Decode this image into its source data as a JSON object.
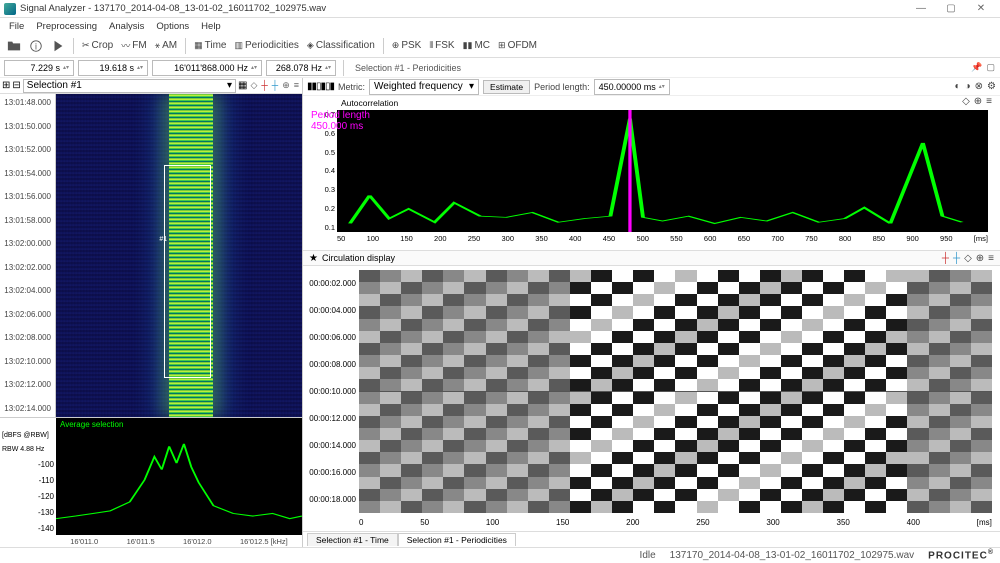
{
  "window": {
    "title": "Signal Analyzer - 137170_2014-04-08_13-01-02_16011702_102975.wav",
    "min": "—",
    "max": "▢",
    "close": "✕"
  },
  "menu": [
    "File",
    "Preprocessing",
    "Analysis",
    "Options",
    "Help"
  ],
  "toolbar": {
    "crop": "Crop",
    "fm": "FM",
    "am": "AM",
    "time": "Time",
    "periodicities": "Periodicities",
    "classification": "Classification",
    "psk": "PSK",
    "fsk": "FSK",
    "mc": "MC",
    "ofdm": "OFDM"
  },
  "values": {
    "t_start": "7.229 s",
    "t_len": "19.618 s",
    "freq": "16'011'868.000 Hz",
    "bw": "268.078 Hz"
  },
  "selection_header_right": "Selection #1 - Periodicities",
  "sel_combo": "Selection #1",
  "spec_times": [
    "13:01:48.000",
    "13:01:50.000",
    "13:01:52.000",
    "13:01:54.000",
    "13:01:56.000",
    "13:01:58.000",
    "13:02:00.000",
    "13:02:02.000",
    "13:02:04.000",
    "13:02:06.000",
    "13:02:08.000",
    "13:02:10.000",
    "13:02:12.000",
    "13:02:14.000"
  ],
  "spec_marker": "#1",
  "bottom_spec": {
    "ylabel_top": "[dBFS @RBW]",
    "ylabel_sub": "RBW 4.88 Hz",
    "avg_label": "Average selection",
    "yticks": [
      "-100",
      "-110",
      "-120",
      "-130",
      "-140"
    ],
    "xticks": [
      "16'011.0",
      "16'011.5",
      "16'012.0",
      "16'012.5 [kHz]"
    ]
  },
  "autocorr": {
    "metric_label": "Metric:",
    "metric_value": "Weighted frequency",
    "estimate_btn": "Estimate",
    "period_label": "Period length:",
    "period_value": "450.00000 ms",
    "title": "Autocorrelation",
    "yticks": [
      "0.7",
      "0.6",
      "0.5",
      "0.4",
      "0.3",
      "0.2",
      "0.1"
    ],
    "xticks": [
      "50",
      "100",
      "150",
      "200",
      "250",
      "300",
      "350",
      "400",
      "450",
      "500",
      "550",
      "600",
      "650",
      "700",
      "750",
      "800",
      "850",
      "900",
      "950",
      "[ms]"
    ],
    "marker_line1": "Period length",
    "marker_line2": "450.000 ms"
  },
  "circulation": {
    "title": "Circulation display",
    "yticks": [
      "00:00:02.000",
      "00:00:04.000",
      "00:00:06.000",
      "00:00:08.000",
      "00:00:10.000",
      "00:00:12.000",
      "00:00:14.000",
      "00:00:16.000",
      "00:00:18.000"
    ],
    "xticks": [
      "0",
      "50",
      "100",
      "150",
      "200",
      "250",
      "300",
      "350",
      "400",
      "[ms]"
    ]
  },
  "tabs": {
    "t1": "Selection #1 - Time",
    "t2": "Selection #1 - Periodicities"
  },
  "status": {
    "idle": "Idle",
    "file": "137170_2014-04-08_13-01-02_16011702_102975.wav",
    "brand": "PROCITEC"
  },
  "chart_data": [
    {
      "type": "line",
      "name": "autocorrelation",
      "xlabel": "ms",
      "ylabel": "",
      "ylim": [
        0,
        0.75
      ],
      "xlim": [
        0,
        1000
      ],
      "x": [
        20,
        50,
        80,
        110,
        150,
        180,
        220,
        260,
        300,
        340,
        380,
        420,
        450,
        470,
        500,
        540,
        580,
        620,
        660,
        700,
        740,
        780,
        810,
        850,
        900,
        930,
        960
      ],
      "values": [
        0.05,
        0.22,
        0.08,
        0.14,
        0.06,
        0.18,
        0.1,
        0.09,
        0.12,
        0.06,
        0.08,
        0.1,
        0.7,
        0.09,
        0.07,
        0.1,
        0.05,
        0.09,
        0.07,
        0.12,
        0.06,
        0.08,
        0.15,
        0.05,
        0.55,
        0.1,
        0.06
      ],
      "marker": {
        "x": 450,
        "label": "Period length 450.000 ms"
      }
    },
    {
      "type": "line",
      "name": "spectrum_avg",
      "xlabel": "kHz",
      "ylabel": "dBFS @RBW",
      "ylim": [
        -140,
        -95
      ],
      "xlim": [
        16010.8,
        16012.7
      ],
      "x": [
        16010.8,
        16011.0,
        16011.2,
        16011.4,
        16011.5,
        16011.6,
        16011.7,
        16011.8,
        16011.9,
        16012.0,
        16012.1,
        16012.3,
        16012.5,
        16012.7
      ],
      "values": [
        -132,
        -130,
        -128,
        -120,
        -108,
        -100,
        -104,
        -100,
        -108,
        -120,
        -128,
        -130,
        -130,
        -132
      ]
    }
  ]
}
